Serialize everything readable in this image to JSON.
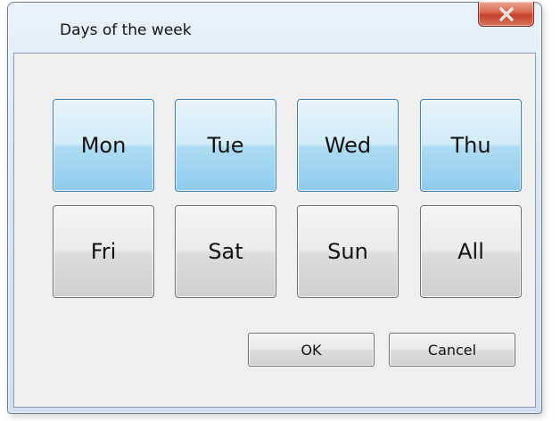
{
  "window": {
    "title": "Days of the week",
    "close_glyph": "✕"
  },
  "days": {
    "mon": "Mon",
    "tue": "Tue",
    "wed": "Wed",
    "thu": "Thu",
    "fri": "Fri",
    "sat": "Sat",
    "sun": "Sun",
    "all": "All"
  },
  "selected_days": [
    "Mon",
    "Tue",
    "Wed",
    "Thu"
  ],
  "buttons": {
    "ok": "OK",
    "cancel": "Cancel"
  },
  "colors": {
    "selected_button": "#aedbf3",
    "close_button": "#c3412a"
  }
}
